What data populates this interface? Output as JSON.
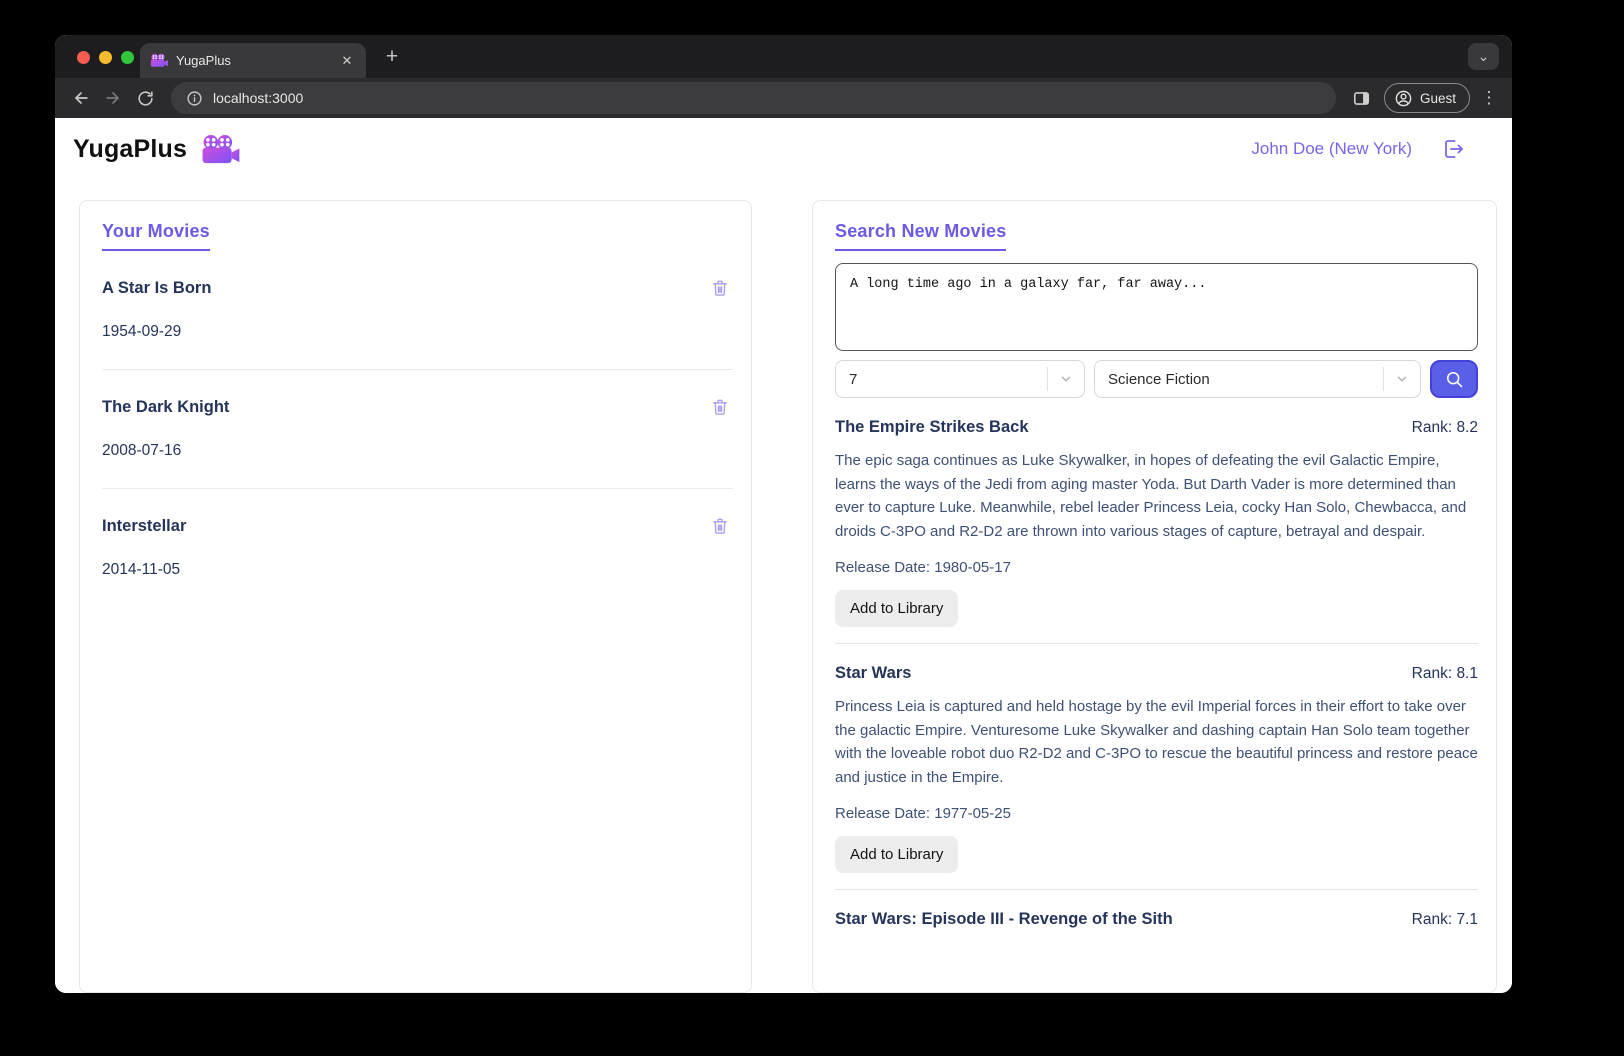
{
  "browser": {
    "tab_title": "YugaPlus",
    "url": "localhost:3000",
    "guest_label": "Guest",
    "icons": {
      "close": "✕",
      "plus": "+",
      "dots": "⋮",
      "chevron": "⌄"
    }
  },
  "header": {
    "app_title": "YugaPlus",
    "user": "John Doe (New York)"
  },
  "library": {
    "title": "Your Movies",
    "movies": [
      {
        "title": "A Star Is Born",
        "date": "1954-09-29"
      },
      {
        "title": "The Dark Knight",
        "date": "2008-07-16"
      },
      {
        "title": "Interstellar",
        "date": "2014-11-05"
      }
    ]
  },
  "search": {
    "title": "Search New Movies",
    "query": "A long time ago in a galaxy far, far away...",
    "rank_value": "7",
    "category_value": "Science Fiction",
    "add_label": "Add to Library",
    "results": [
      {
        "title": "The Empire Strikes Back",
        "rank": "Rank: 8.2",
        "description": "The epic saga continues as Luke Skywalker, in hopes of defeating the evil Galactic Empire, learns the ways of the Jedi from aging master Yoda. But Darth Vader is more determined than ever to capture Luke. Meanwhile, rebel leader Princess Leia, cocky Han Solo, Chewbacca, and droids C-3PO and R2-D2 are thrown into various stages of capture, betrayal and despair.",
        "release": "Release Date: 1980-05-17"
      },
      {
        "title": "Star Wars",
        "rank": "Rank: 8.1",
        "description": "Princess Leia is captured and held hostage by the evil Imperial forces in their effort to take over the galactic Empire. Venturesome Luke Skywalker and dashing captain Han Solo team together with the loveable robot duo R2-D2 and C-3PO to rescue the beautiful princess and restore peace and justice in the Empire.",
        "release": "Release Date: 1977-05-25"
      },
      {
        "title": "Star Wars: Episode III - Revenge of the Sith",
        "rank": "Rank: 7.1"
      }
    ]
  },
  "colors": {
    "accent_purple": "#6b5ae4",
    "link_purple": "#7568ea",
    "navy_text": "#25345a",
    "slate_text": "#3e5174",
    "search_button": "#5a5fe8",
    "trash_icon": "#a79bf5"
  }
}
